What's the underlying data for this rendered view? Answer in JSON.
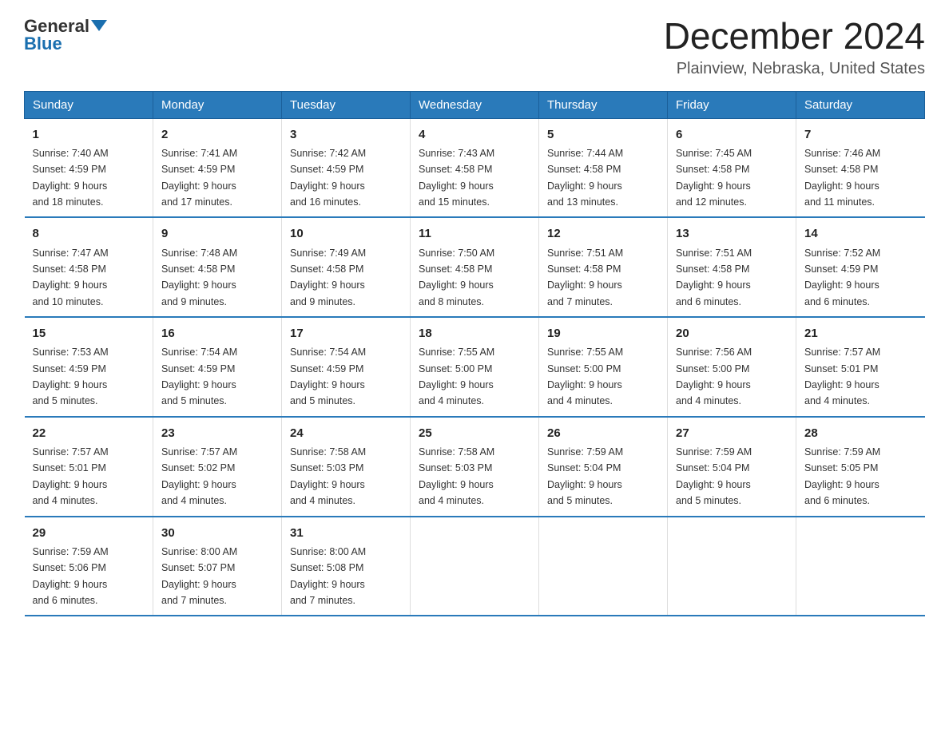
{
  "header": {
    "logo_general": "General",
    "logo_blue": "Blue",
    "month_title": "December 2024",
    "location": "Plainview, Nebraska, United States"
  },
  "days_of_week": [
    "Sunday",
    "Monday",
    "Tuesday",
    "Wednesday",
    "Thursday",
    "Friday",
    "Saturday"
  ],
  "weeks": [
    [
      {
        "day": "1",
        "sunrise": "7:40 AM",
        "sunset": "4:59 PM",
        "daylight": "9 hours and 18 minutes."
      },
      {
        "day": "2",
        "sunrise": "7:41 AM",
        "sunset": "4:59 PM",
        "daylight": "9 hours and 17 minutes."
      },
      {
        "day": "3",
        "sunrise": "7:42 AM",
        "sunset": "4:59 PM",
        "daylight": "9 hours and 16 minutes."
      },
      {
        "day": "4",
        "sunrise": "7:43 AM",
        "sunset": "4:58 PM",
        "daylight": "9 hours and 15 minutes."
      },
      {
        "day": "5",
        "sunrise": "7:44 AM",
        "sunset": "4:58 PM",
        "daylight": "9 hours and 13 minutes."
      },
      {
        "day": "6",
        "sunrise": "7:45 AM",
        "sunset": "4:58 PM",
        "daylight": "9 hours and 12 minutes."
      },
      {
        "day": "7",
        "sunrise": "7:46 AM",
        "sunset": "4:58 PM",
        "daylight": "9 hours and 11 minutes."
      }
    ],
    [
      {
        "day": "8",
        "sunrise": "7:47 AM",
        "sunset": "4:58 PM",
        "daylight": "9 hours and 10 minutes."
      },
      {
        "day": "9",
        "sunrise": "7:48 AM",
        "sunset": "4:58 PM",
        "daylight": "9 hours and 9 minutes."
      },
      {
        "day": "10",
        "sunrise": "7:49 AM",
        "sunset": "4:58 PM",
        "daylight": "9 hours and 9 minutes."
      },
      {
        "day": "11",
        "sunrise": "7:50 AM",
        "sunset": "4:58 PM",
        "daylight": "9 hours and 8 minutes."
      },
      {
        "day": "12",
        "sunrise": "7:51 AM",
        "sunset": "4:58 PM",
        "daylight": "9 hours and 7 minutes."
      },
      {
        "day": "13",
        "sunrise": "7:51 AM",
        "sunset": "4:58 PM",
        "daylight": "9 hours and 6 minutes."
      },
      {
        "day": "14",
        "sunrise": "7:52 AM",
        "sunset": "4:59 PM",
        "daylight": "9 hours and 6 minutes."
      }
    ],
    [
      {
        "day": "15",
        "sunrise": "7:53 AM",
        "sunset": "4:59 PM",
        "daylight": "9 hours and 5 minutes."
      },
      {
        "day": "16",
        "sunrise": "7:54 AM",
        "sunset": "4:59 PM",
        "daylight": "9 hours and 5 minutes."
      },
      {
        "day": "17",
        "sunrise": "7:54 AM",
        "sunset": "4:59 PM",
        "daylight": "9 hours and 5 minutes."
      },
      {
        "day": "18",
        "sunrise": "7:55 AM",
        "sunset": "5:00 PM",
        "daylight": "9 hours and 4 minutes."
      },
      {
        "day": "19",
        "sunrise": "7:55 AM",
        "sunset": "5:00 PM",
        "daylight": "9 hours and 4 minutes."
      },
      {
        "day": "20",
        "sunrise": "7:56 AM",
        "sunset": "5:00 PM",
        "daylight": "9 hours and 4 minutes."
      },
      {
        "day": "21",
        "sunrise": "7:57 AM",
        "sunset": "5:01 PM",
        "daylight": "9 hours and 4 minutes."
      }
    ],
    [
      {
        "day": "22",
        "sunrise": "7:57 AM",
        "sunset": "5:01 PM",
        "daylight": "9 hours and 4 minutes."
      },
      {
        "day": "23",
        "sunrise": "7:57 AM",
        "sunset": "5:02 PM",
        "daylight": "9 hours and 4 minutes."
      },
      {
        "day": "24",
        "sunrise": "7:58 AM",
        "sunset": "5:03 PM",
        "daylight": "9 hours and 4 minutes."
      },
      {
        "day": "25",
        "sunrise": "7:58 AM",
        "sunset": "5:03 PM",
        "daylight": "9 hours and 4 minutes."
      },
      {
        "day": "26",
        "sunrise": "7:59 AM",
        "sunset": "5:04 PM",
        "daylight": "9 hours and 5 minutes."
      },
      {
        "day": "27",
        "sunrise": "7:59 AM",
        "sunset": "5:04 PM",
        "daylight": "9 hours and 5 minutes."
      },
      {
        "day": "28",
        "sunrise": "7:59 AM",
        "sunset": "5:05 PM",
        "daylight": "9 hours and 6 minutes."
      }
    ],
    [
      {
        "day": "29",
        "sunrise": "7:59 AM",
        "sunset": "5:06 PM",
        "daylight": "9 hours and 6 minutes."
      },
      {
        "day": "30",
        "sunrise": "8:00 AM",
        "sunset": "5:07 PM",
        "daylight": "9 hours and 7 minutes."
      },
      {
        "day": "31",
        "sunrise": "8:00 AM",
        "sunset": "5:08 PM",
        "daylight": "9 hours and 7 minutes."
      },
      null,
      null,
      null,
      null
    ]
  ],
  "labels": {
    "sunrise": "Sunrise:",
    "sunset": "Sunset:",
    "daylight": "Daylight:"
  }
}
